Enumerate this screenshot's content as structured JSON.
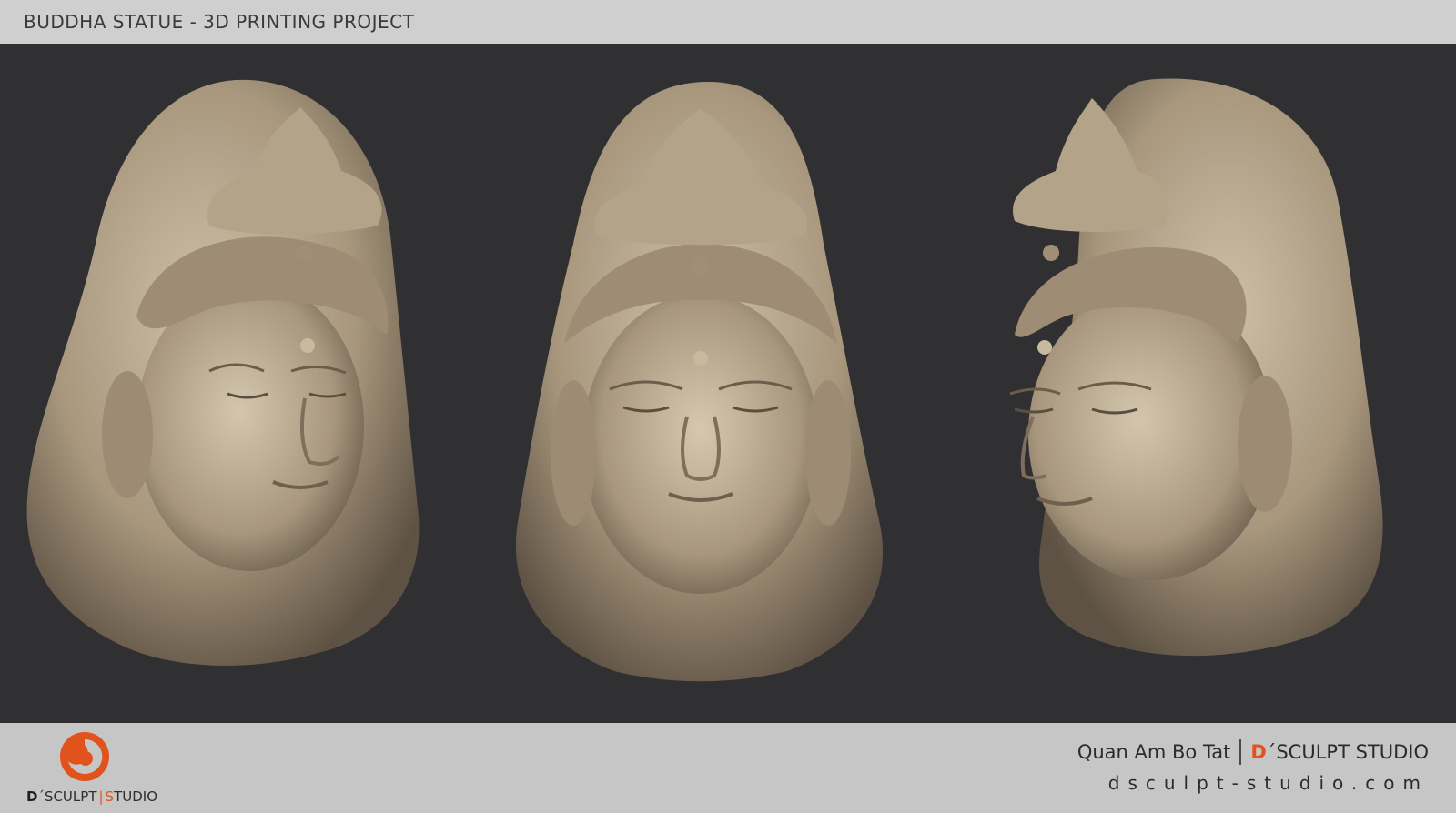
{
  "header": {
    "title": "BUDDHA STATUE - 3D PRINTING PROJECT"
  },
  "viewport": {
    "background_color": "#303032",
    "material_color": "#b5a58c",
    "views": [
      {
        "name": "three-quarter-left-view"
      },
      {
        "name": "front-view"
      },
      {
        "name": "three-quarter-right-view"
      }
    ]
  },
  "footer": {
    "logo": {
      "text_d": "D",
      "text_rest": "´SCULPT",
      "text_sep": "|",
      "text_s": "S",
      "text_studio": "TUDIO",
      "accent_color": "#e0531d"
    },
    "project_name": "Quan Am Bo Tat",
    "studio_d": "D",
    "studio_rest": "´SCULPT STUDIO",
    "website": "dsculpt-studio.com"
  }
}
